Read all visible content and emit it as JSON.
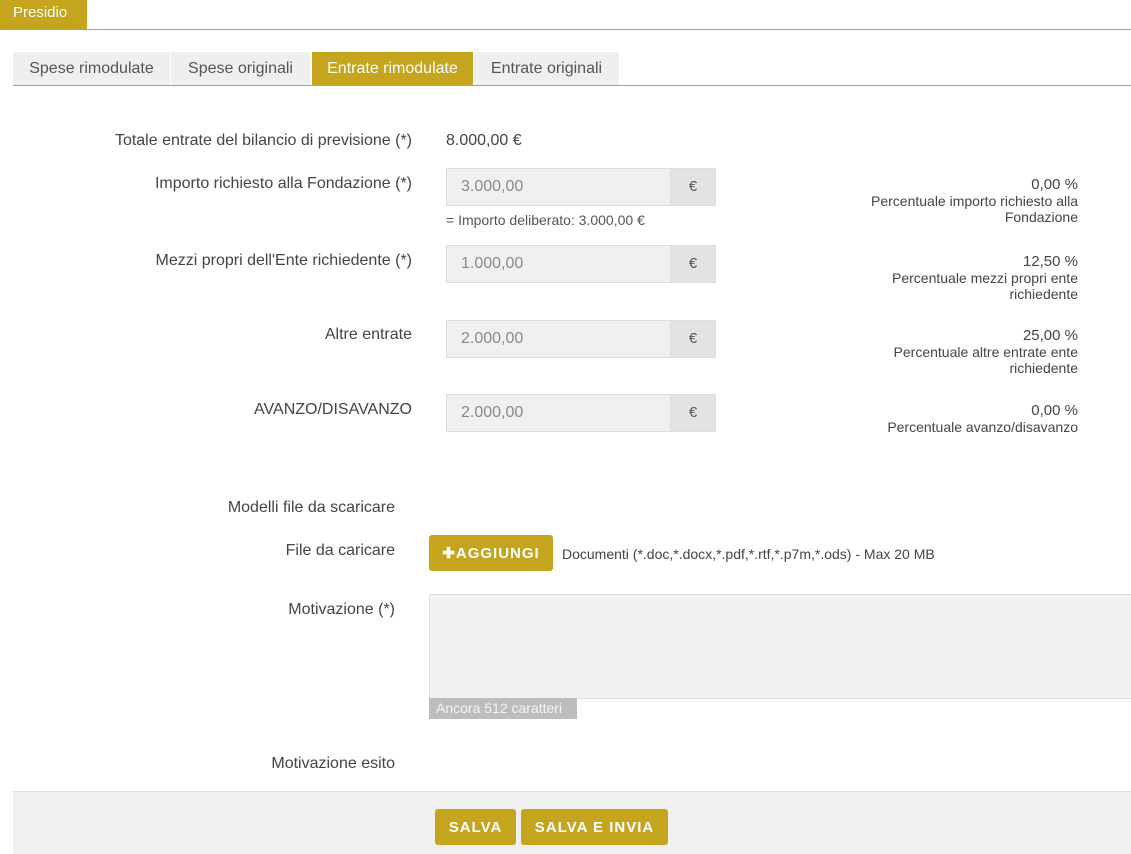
{
  "header": {
    "title": "Presidio"
  },
  "tabs": [
    {
      "label": "Spese rimodulate"
    },
    {
      "label": "Spese originali"
    },
    {
      "label": "Entrate rimodulate"
    },
    {
      "label": "Entrate originali"
    }
  ],
  "form": {
    "totale": {
      "label": "Totale entrate del bilancio di previsione (*)",
      "value": "8.000,00 €"
    },
    "importo": {
      "label": "Importo richiesto alla Fondazione (*)",
      "value": "3.000,00",
      "currency": "€",
      "hint": "= Importo deliberato: 3.000,00 €",
      "pct": "0,00 %",
      "pct_label": "Percentuale importo richiesto alla Fondazione"
    },
    "mezzi": {
      "label": "Mezzi propri dell'Ente richiedente (*)",
      "value": "1.000,00",
      "currency": "€",
      "pct": "12,50 %",
      "pct_label": "Percentuale mezzi propri ente richiedente"
    },
    "altre": {
      "label": "Altre entrate",
      "value": "2.000,00",
      "currency": "€",
      "pct": "25,00 %",
      "pct_label": "Percentuale altre entrate ente richiedente"
    },
    "avanzo": {
      "label": "AVANZO/DISAVANZO",
      "value": "2.000,00",
      "currency": "€",
      "pct": "0,00 %",
      "pct_label": "Percentuale avanzo/disavanzo"
    }
  },
  "files": {
    "modelli_label": "Modelli file da scaricare",
    "upload_label": "File da caricare",
    "add_button": "✚AGGIUNGI",
    "note": "Documenti (*.doc,*.docx,*.pdf,*.rtf,*.p7m,*.ods) - Max 20 MB"
  },
  "motivazione": {
    "label": "Motivazione (*)",
    "value": "",
    "counter": "Ancora 512 caratteri"
  },
  "motivazione_esito": {
    "label": "Motivazione esito"
  },
  "footer": {
    "save": "SALVA",
    "send": "SALVA E INVIA"
  },
  "colors": {
    "accent": "#c5a41e"
  }
}
